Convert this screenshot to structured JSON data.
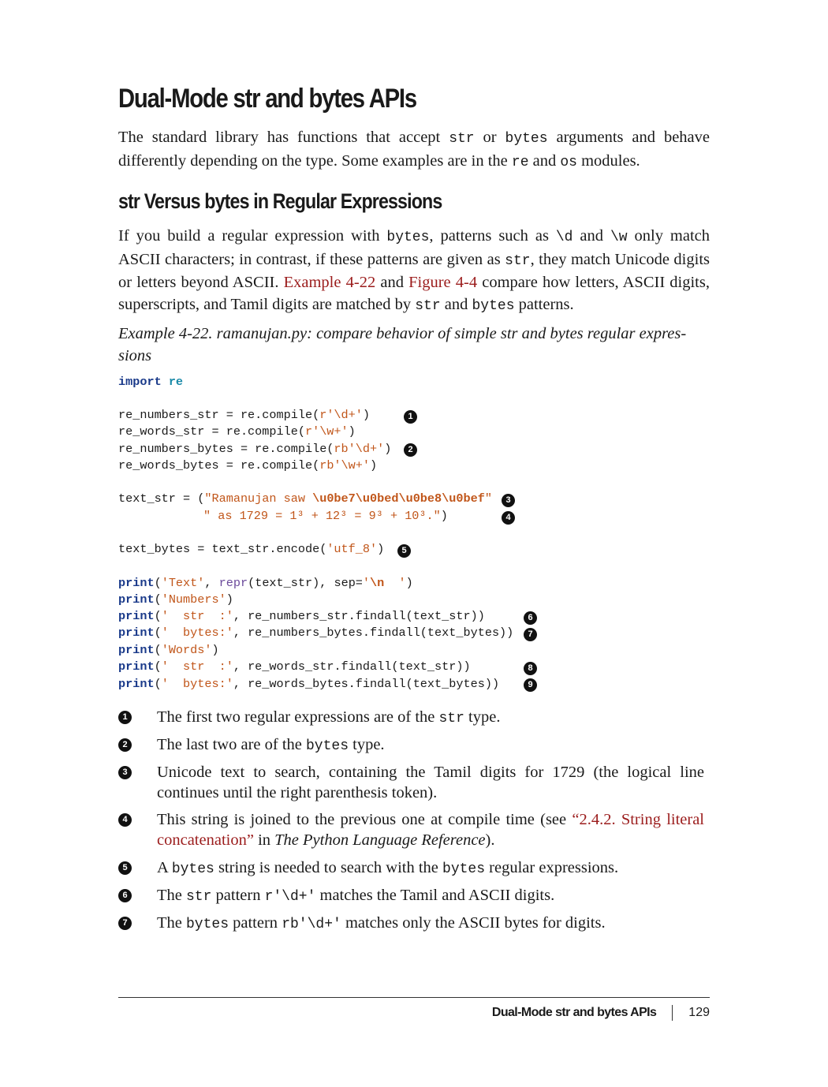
{
  "section_title": "Dual-Mode str and bytes APIs",
  "intro": {
    "t1": "The standard library has functions that accept ",
    "c1": "str",
    "t2": " or ",
    "c2": "bytes",
    "t3": " arguments and behave differently depending on the type. Some examples are in the ",
    "c3": "re",
    "t4": " and ",
    "c4": "os",
    "t5": " modules."
  },
  "subsection_title": "str Versus bytes in Regular Expressions",
  "body": {
    "t1": "If you build a regular expression with ",
    "c1": "bytes",
    "t2": ", patterns such as ",
    "c2": "\\d",
    "t3": " and ",
    "c3": "\\w",
    "t4": " only match ASCII characters; in contrast, if these patterns are given as ",
    "c4": "str",
    "t5": ", they match Unicode digits or letters beyond ASCII. ",
    "link1": "Example 4-22",
    "t6": " and ",
    "link2": "Figure 4-4",
    "t7": " compare how letters, ASCII digits, superscripts, and Tamil digits are matched by ",
    "c5": "str",
    "t8": " and ",
    "c6": "bytes",
    "t9": " patterns."
  },
  "caption": "Example 4-22. ramanujan.py: compare behavior of simple str and bytes regular expres­sions",
  "code": {
    "l1": {
      "kw": "import",
      "mod": "re"
    },
    "l2": {
      "a": "re_numbers_str = re.compile(",
      "s": "r'\\d+'",
      "b": ")"
    },
    "l3": {
      "a": "re_words_str = re.compile(",
      "s": "r'\\w+'",
      "b": ")"
    },
    "l4": {
      "a": "re_numbers_bytes = re.compile(",
      "s": "rb'\\d+'",
      "b": ")"
    },
    "l5": {
      "a": "re_words_bytes = re.compile(",
      "s": "rb'\\w+'",
      "b": ")"
    },
    "l6": {
      "a": "text_str = (",
      "s": "\"Ramanujan saw ",
      "e": "\\u0be7\\u0bed\\u0be8\\u0bef",
      "s2": "\""
    },
    "l7": {
      "s": "\" as 1729 = 1³ + 12³ = 9³ + 10³.\"",
      "b": ")"
    },
    "l8": {
      "a": "text_bytes = text_str.encode(",
      "s": "'utf_8'",
      "b": ")"
    },
    "l9": {
      "kw": "print",
      "p": "(",
      "s": "'Text'",
      "m": ", ",
      "fn": "repr",
      "a": "(text_str), sep=",
      "s2": "'",
      "e": "\\n",
      "s3": "  '",
      "b": ")"
    },
    "l10": {
      "kw": "print",
      "p": "(",
      "s": "'Numbers'",
      "b": ")"
    },
    "l11": {
      "kw": "print",
      "p": "(",
      "s": "'  str  :'",
      "a": ", re_numbers_str.findall(text_str))"
    },
    "l12": {
      "kw": "print",
      "p": "(",
      "s": "'  bytes:'",
      "a": ", re_numbers_bytes.findall(text_bytes))"
    },
    "l13": {
      "kw": "print",
      "p": "(",
      "s": "'Words'",
      "b": ")"
    },
    "l14": {
      "kw": "print",
      "p": "(",
      "s": "'  str  :'",
      "a": ", re_words_str.findall(text_str))"
    },
    "l15": {
      "kw": "print",
      "p": "(",
      "s": "'  bytes:'",
      "a": ", re_words_bytes.findall(text_bytes))"
    }
  },
  "callouts": [
    "1",
    "2",
    "3",
    "4",
    "5",
    "6",
    "7",
    "8",
    "9"
  ],
  "notes": [
    {
      "t1": "The first two regular expressions are of the ",
      "c1": "str",
      "t2": " type."
    },
    {
      "t1": "The last two are of the ",
      "c1": "bytes",
      "t2": " type."
    },
    {
      "t1": "Unicode text to search, containing the Tamil digits for 1729 (the logical line continues until the right parenthesis token)."
    },
    {
      "t1": "This string is joined to the previous one at compile time (see ",
      "link": "“2.4.2. String literal concatenation”",
      "t2": " in ",
      "em": "The Python Language Reference",
      "t3": ")."
    },
    {
      "t1": "A ",
      "c1": "bytes",
      "t2": " string is needed to search with the ",
      "c2": "bytes",
      "t3": " regular expressions."
    },
    {
      "t1": "The ",
      "c1": "str",
      "t2": " pattern ",
      "c2": "r'\\d+'",
      "t3": " matches the Tamil and ASCII digits."
    },
    {
      "t1": "The ",
      "c1": "bytes",
      "t2": " pattern ",
      "c2": "rb'\\d+'",
      "t3": " matches only the ASCII bytes for digits."
    }
  ],
  "footer": {
    "running_title": "Dual-Mode str and bytes APIs",
    "page_number": "129"
  },
  "colors": {
    "link": "#9b1c1c",
    "code_keyword": "#1a3a8a",
    "code_module": "#1a8aa8",
    "code_string": "#c1561a",
    "code_builtin": "#6b4a9b"
  }
}
